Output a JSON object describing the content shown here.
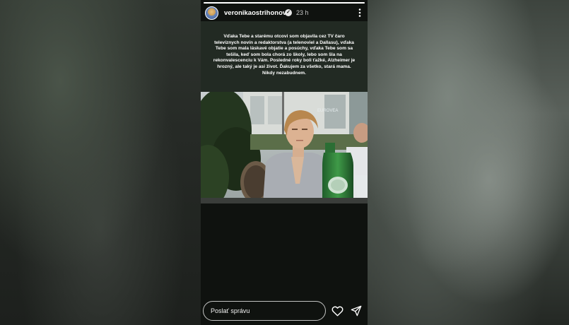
{
  "story": {
    "progress": 1.0,
    "header": {
      "username": "veronikaostrihonova",
      "verified_glyph": "✓",
      "timestamp": "23 h",
      "more_icon": "more-vertical-icon"
    },
    "caption": "Vďaka Tebe a starému otcovi som objavila cez TV čaro televíznych novín a redaktorstva (a telenoviel a Dallasu), vďaka Tebe som mala láskavé objatie a posúchy, vďaka Tebe som sa tešila, keď som bola chorá zo školy, lebo som šla na rekonvalescenciu k Vám. Posledné roky boli ťažké, Alzheimer je hrozný, ale taký je asi život. Ďakujem za všetko, stará mama. Nikdy nezabudnem.",
    "photo": {
      "sign_text": "EUROVEA"
    }
  },
  "reply": {
    "placeholder": "Poslať správu",
    "like_icon": "heart-icon",
    "share_icon": "send-icon"
  },
  "colors": {
    "story_background": "#0f120f",
    "caption_background": "#222a23",
    "text": "#ffffff"
  }
}
